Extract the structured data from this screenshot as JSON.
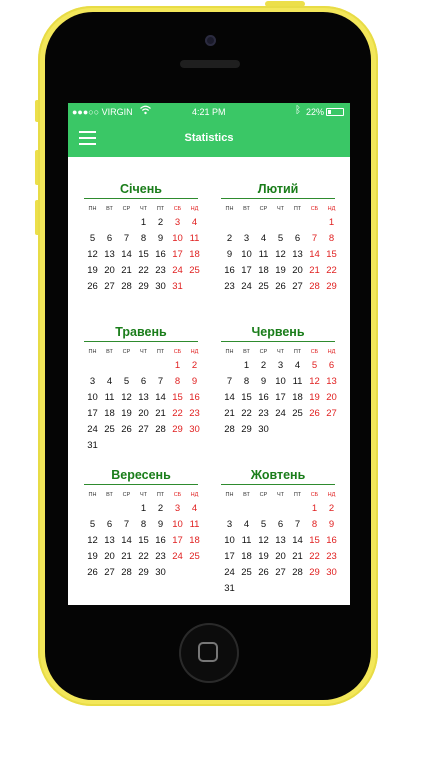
{
  "status": {
    "carrier": "●●●○○ VIRGIN",
    "time": "4:21 PM",
    "battery": "22%"
  },
  "nav": {
    "title": "Statistics"
  },
  "weekdays": [
    "ПН",
    "ВТ",
    "СР",
    "ЧТ",
    "ПТ",
    "СБ",
    "НД"
  ],
  "months": [
    {
      "name": "Січень",
      "start": 3,
      "days": 31
    },
    {
      "name": "Лютий",
      "start": 6,
      "days": 29
    },
    {
      "name": "Травень",
      "start": 5,
      "days": 31
    },
    {
      "name": "Червень",
      "start": 1,
      "days": 30
    },
    {
      "name": "Вересень",
      "start": 3,
      "days": 30
    },
    {
      "name": "Жовтень",
      "start": 5,
      "days": 31
    }
  ]
}
